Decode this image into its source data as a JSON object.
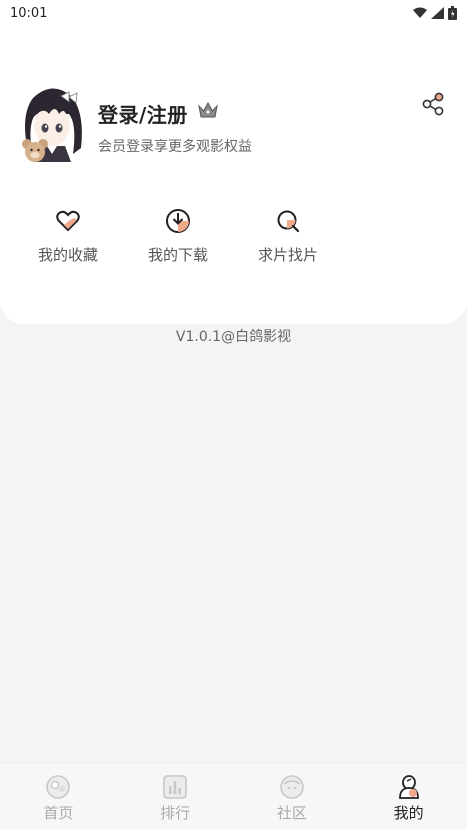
{
  "status_bar": {
    "time": "10:01",
    "icons": [
      "wifi-icon",
      "signal-icon",
      "battery-icon"
    ]
  },
  "profile": {
    "login_label": "登录/注册",
    "subtitle": "会员登录享更多观影权益",
    "avatar": "anime-girl-avatar",
    "badge_icon": "crown-icon",
    "share_icon": "share-icon"
  },
  "quick_actions": [
    {
      "label": "我的收藏",
      "icon": "heart-icon"
    },
    {
      "label": "我的下载",
      "icon": "download-icon"
    },
    {
      "label": "求片找片",
      "icon": "search-icon"
    }
  ],
  "version": "V1.0.1@白鸽影视",
  "tabs": [
    {
      "label": "首页",
      "icon": "home-icon",
      "active": false
    },
    {
      "label": "排行",
      "icon": "ranking-icon",
      "active": false
    },
    {
      "label": "社区",
      "icon": "community-icon",
      "active": false
    },
    {
      "label": "我的",
      "icon": "profile-icon",
      "active": true
    }
  ],
  "colors": {
    "accent": "#f0a98a",
    "background": "#f4f4f4",
    "card": "#ffffff"
  }
}
